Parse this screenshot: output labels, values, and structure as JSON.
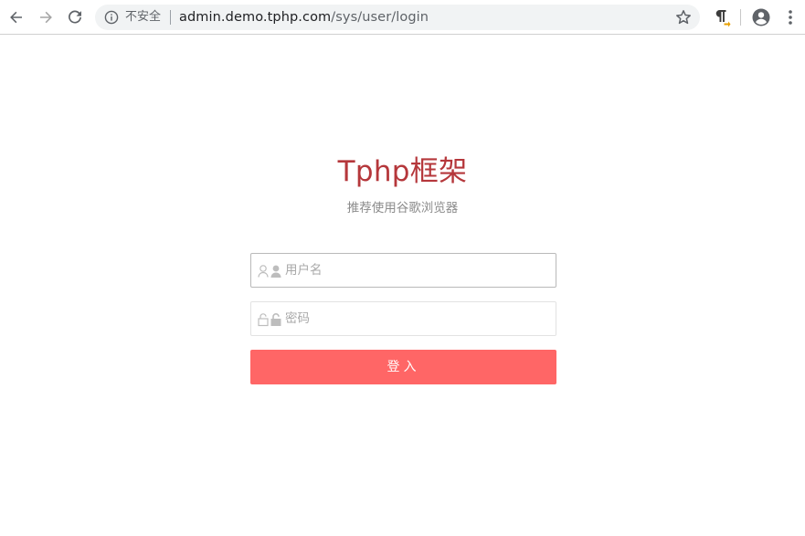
{
  "browser": {
    "security_label": "不安全",
    "url_host": "admin.demo.tphp.com",
    "url_path": "/sys/user/login",
    "icons": {
      "back": "back-arrow-icon",
      "forward": "forward-arrow-icon",
      "reload": "reload-icon",
      "info": "info-icon",
      "bookmark": "star-icon",
      "extension": "pilcrow-extension-icon",
      "profile": "profile-icon",
      "menu": "kebab-menu-icon"
    }
  },
  "page": {
    "title": "Tphp框架",
    "subtitle": "推荐使用谷歌浏览器",
    "accent_color": "#b5373b",
    "button_color": "#ff6666"
  },
  "login_form": {
    "username": {
      "placeholder": "用户名",
      "value": ""
    },
    "password": {
      "placeholder": "密码",
      "value": ""
    },
    "submit_label": "登入"
  }
}
